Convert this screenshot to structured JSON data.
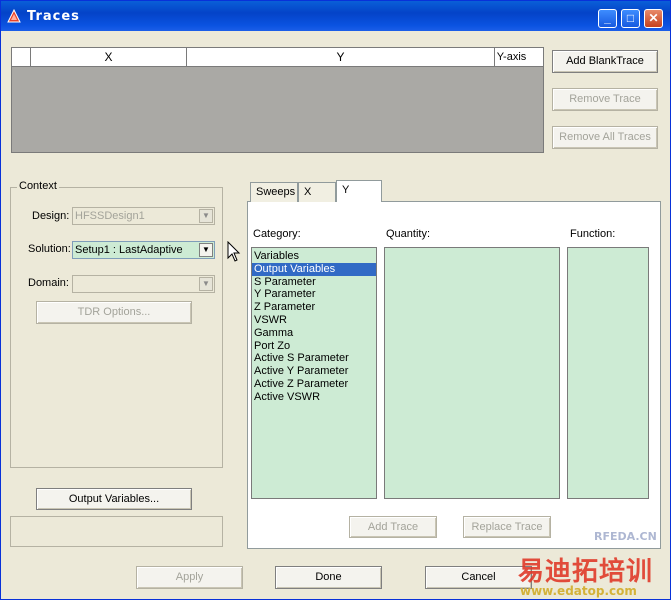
{
  "window": {
    "title": "Traces"
  },
  "grid": {
    "col_x": "X",
    "col_y": "Y",
    "col_yaxis": "Y-axis"
  },
  "right_buttons": {
    "add_blank": "Add BlankTrace",
    "remove": "Remove Trace",
    "remove_all": "Remove All Traces"
  },
  "context": {
    "title": "Context",
    "design_label": "Design:",
    "design_value": "HFSSDesign1",
    "solution_label": "Solution:",
    "solution_value": "Setup1 : LastAdaptive",
    "domain_label": "Domain:",
    "domain_value": "",
    "tdr_button": "TDR Options..."
  },
  "output_variables_button": "Output Variables...",
  "tabs": [
    {
      "label": "Sweeps"
    },
    {
      "label": "X"
    },
    {
      "label": "Y"
    }
  ],
  "panel": {
    "category_label": "Category:",
    "quantity_label": "Quantity:",
    "function_label": "Function:",
    "categories": [
      "Variables",
      "Output Variables",
      "S Parameter",
      "Y Parameter",
      "Z Parameter",
      "VSWR",
      "Gamma",
      "Port Zo",
      "Active S Parameter",
      "Active Y Parameter",
      "Active Z Parameter",
      "Active VSWR"
    ],
    "selected_index": 1,
    "add_trace": "Add Trace",
    "replace_trace": "Replace Trace"
  },
  "bottom": {
    "apply": "Apply",
    "done": "Done",
    "cancel": "Cancel"
  },
  "watermarks": {
    "rfeda": "RFEDA.CN",
    "cn_text": "易迪拓培训",
    "url": "www.edatop.com"
  },
  "colors": {
    "title_bar": "#0a52e0",
    "list_bg": "#cdebd4",
    "selection": "#316ac5",
    "watermark_red": "#e03a2a"
  }
}
